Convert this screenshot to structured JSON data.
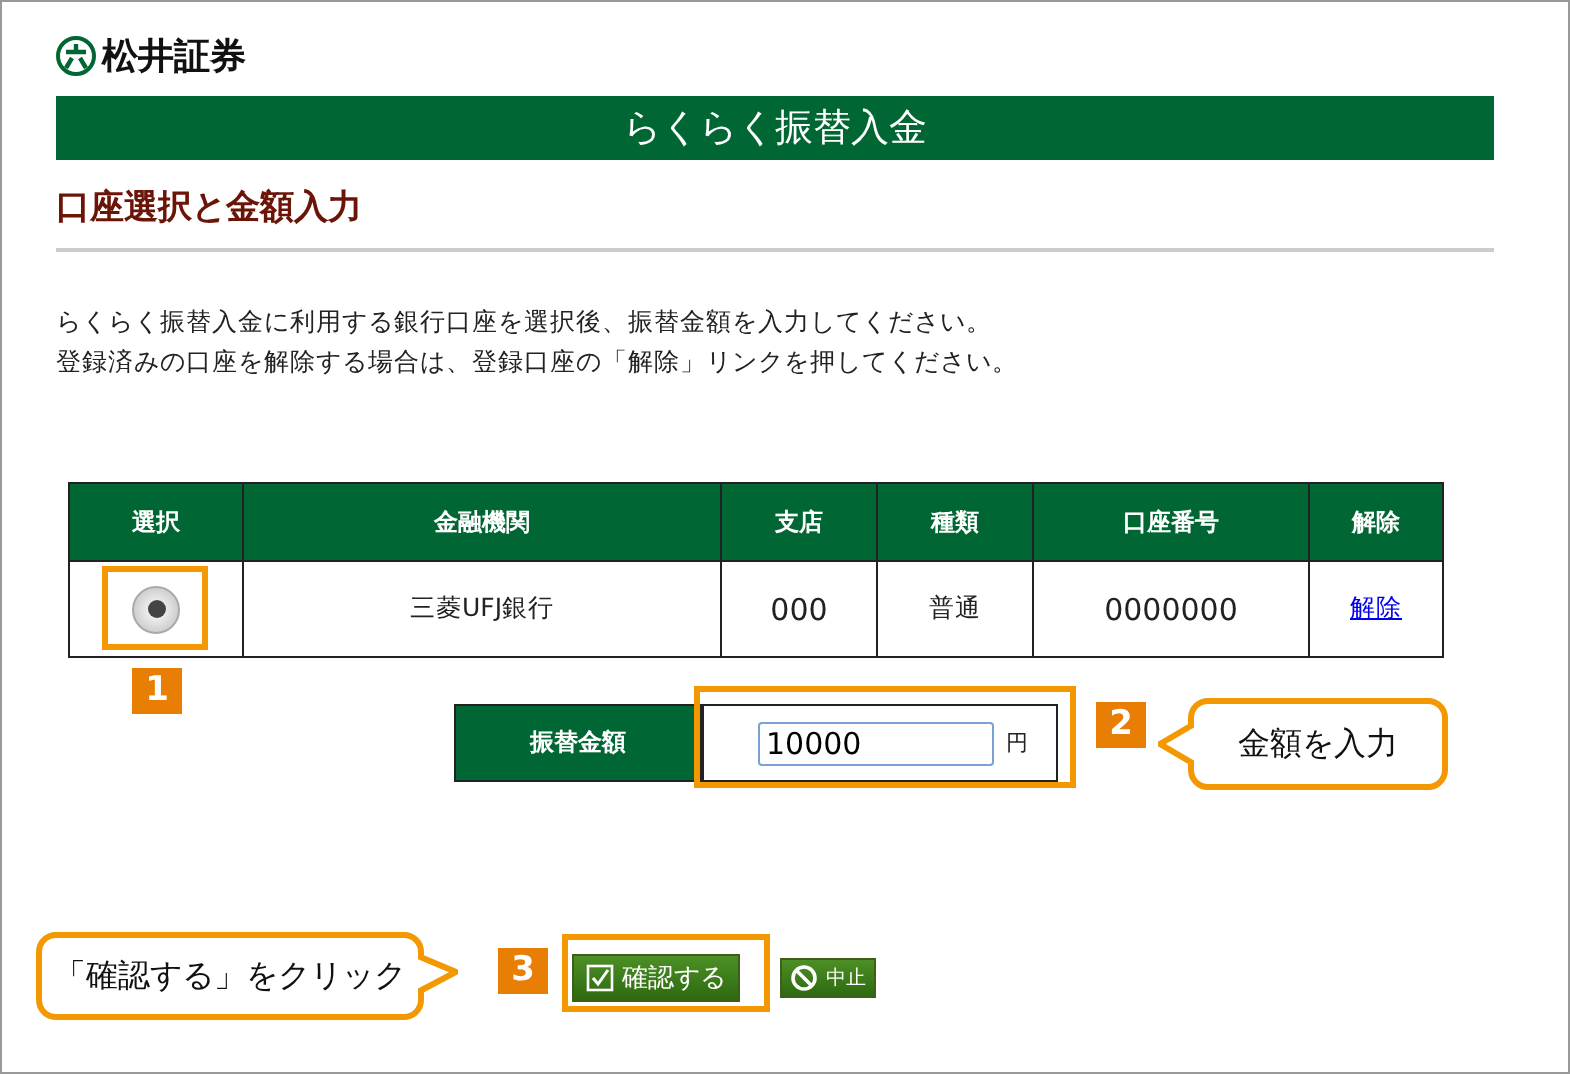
{
  "logo": {
    "text": "松井証券"
  },
  "banner": "らくらく振替入金",
  "heading": "口座選択と金額入力",
  "instructions": [
    "らくらく振替入金に利用する銀行口座を選択後、振替金額を入力してください。",
    "登録済みの口座を解除する場合は、登録口座の「解除」リンクを押してください。"
  ],
  "table": {
    "columns": [
      "選択",
      "金融機関",
      "支店",
      "種類",
      "口座番号",
      "解除"
    ],
    "rows": [
      {
        "selected": true,
        "bank": "三菱UFJ銀行",
        "branch": "000",
        "type": "普通",
        "account": "0000000",
        "action": "解除"
      }
    ]
  },
  "amount": {
    "label": "振替金額",
    "value": "10000",
    "unit": "円"
  },
  "buttons": [
    {
      "kind": "confirm",
      "label": "確認する"
    },
    {
      "kind": "cancel",
      "label": "中止"
    }
  ],
  "annotations": [
    {
      "number": "1"
    },
    {
      "number": "2",
      "callout": "金額を入力"
    },
    {
      "number": "3",
      "callout": "「確認する」をクリック"
    }
  ]
}
